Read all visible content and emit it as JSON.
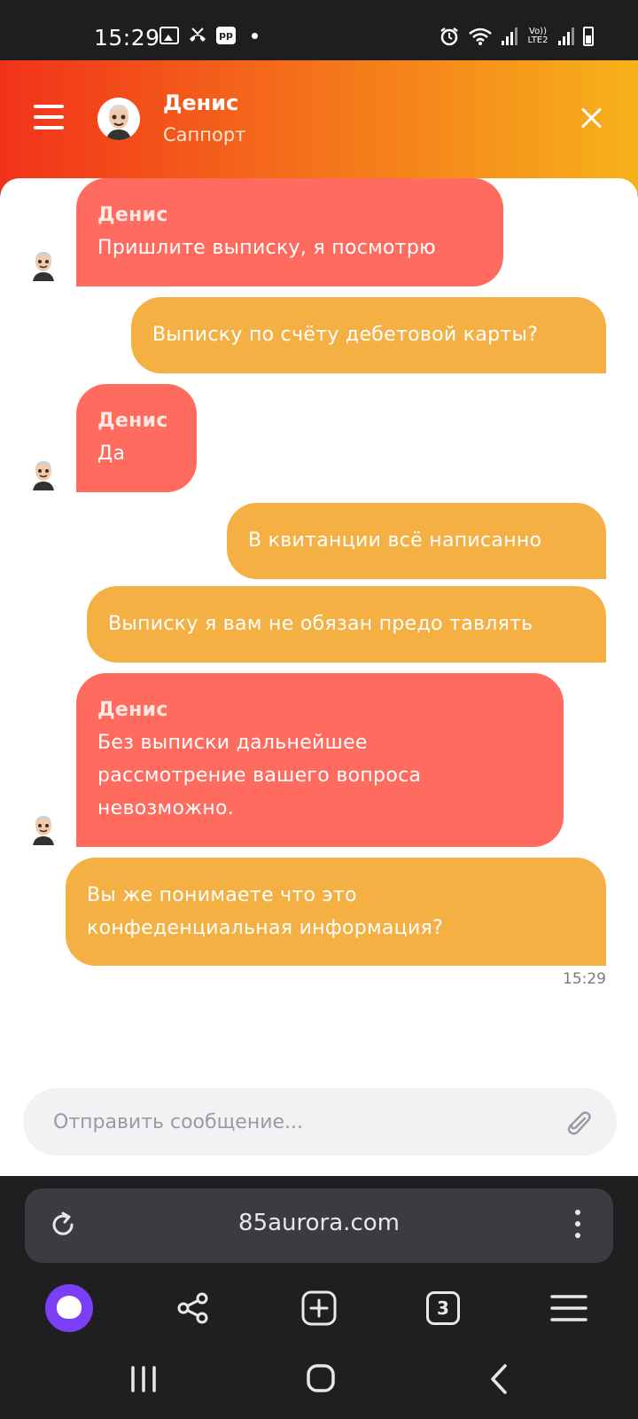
{
  "status_bar": {
    "time": "15:29",
    "notif_badge": "pp",
    "lte_label": "Vo)) LTE2"
  },
  "header": {
    "name": "Денис",
    "role": "Саппорт"
  },
  "messages": [
    {
      "direction": "in",
      "sender": "Денис",
      "text": "Пришлите выписку, я посмотрю"
    },
    {
      "direction": "out",
      "text": "Выписку по счёту дебетовой карты?"
    },
    {
      "direction": "in",
      "sender": "Денис",
      "text": "Да"
    },
    {
      "direction": "out",
      "text": "В квитанции всё написанно"
    },
    {
      "direction": "out",
      "text": "Выписку я вам не обязан предо тавлять"
    },
    {
      "direction": "in",
      "sender": "Денис",
      "lines": [
        "Без выписки дальнейшее",
        "рассмотрение вашего вопроса",
        "невозможно."
      ]
    },
    {
      "direction": "out",
      "lines": [
        "Вы же понимаете что это",
        "конфеденциальная информация?"
      ],
      "time": "15:29"
    }
  ],
  "composer": {
    "placeholder": "Отправить сообщение..."
  },
  "browser": {
    "url": "85aurora.com",
    "tab_count": "3"
  },
  "colors": {
    "incoming": "#ff6b5e",
    "outgoing": "#f5b044",
    "header_start": "#f2321a",
    "header_end": "#f7b21b",
    "alice": "#7b3ff5"
  }
}
